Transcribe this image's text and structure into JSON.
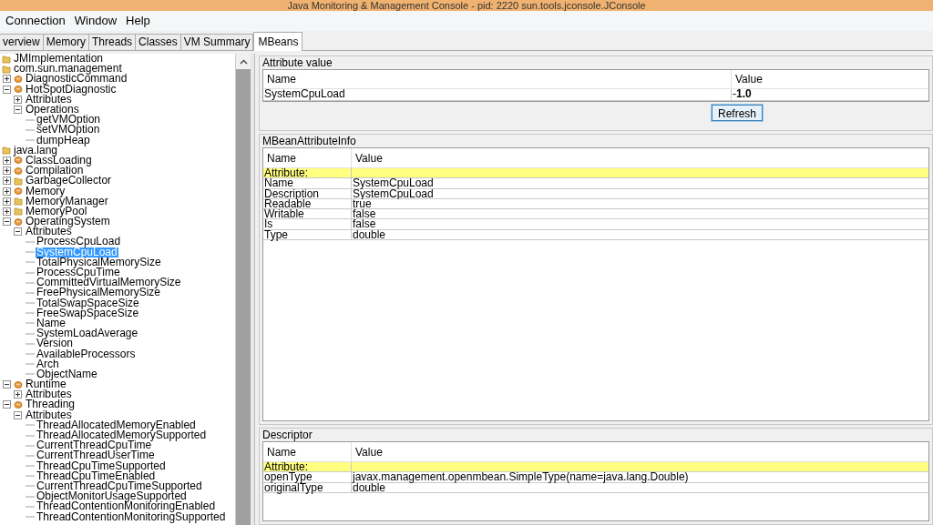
{
  "window": {
    "title": "Java Monitoring & Management Console - pid: 2220 sun.tools.jconsole.JConsole"
  },
  "menu": [
    "Connection",
    "Window",
    "Help"
  ],
  "tabs": [
    {
      "label": "verview",
      "selected": false
    },
    {
      "label": "Memory",
      "selected": false
    },
    {
      "label": "Threads",
      "selected": false
    },
    {
      "label": "Classes",
      "selected": false
    },
    {
      "label": "VM Summary",
      "selected": false
    },
    {
      "label": "MBeans",
      "selected": true
    }
  ],
  "tree": [
    {
      "label": "JMImplementation",
      "kind": "folder",
      "selected": false
    },
    {
      "label": "com.sun.management",
      "kind": "folder",
      "selected": false,
      "children": [
        {
          "label": "DiagnosticCommand",
          "kind": "bean",
          "expanded": false,
          "selected": false
        },
        {
          "label": "HotSpotDiagnostic",
          "kind": "bean",
          "expanded": true,
          "selected": false,
          "children": [
            {
              "label": "Attributes",
              "kind": "group",
              "expanded": false,
              "selected": false
            },
            {
              "label": "Operations",
              "kind": "group",
              "expanded": true,
              "selected": false,
              "children": [
                {
                  "label": "getVMOption",
                  "kind": "leaf",
                  "selected": false
                },
                {
                  "label": "setVMOption",
                  "kind": "leaf",
                  "selected": false
                },
                {
                  "label": "dumpHeap",
                  "kind": "leaf",
                  "selected": false
                }
              ]
            }
          ]
        }
      ]
    },
    {
      "label": "java.lang",
      "kind": "folder",
      "selected": false,
      "children": [
        {
          "label": "ClassLoading",
          "kind": "bean",
          "expanded": false,
          "selected": false
        },
        {
          "label": "Compilation",
          "kind": "bean",
          "expanded": false,
          "selected": false
        },
        {
          "label": "GarbageCollector",
          "kind": "folder",
          "expanded": false,
          "selected": false
        },
        {
          "label": "Memory",
          "kind": "bean",
          "expanded": false,
          "selected": false
        },
        {
          "label": "MemoryManager",
          "kind": "folder",
          "expanded": false,
          "selected": false
        },
        {
          "label": "MemoryPool",
          "kind": "folder",
          "expanded": false,
          "selected": false
        },
        {
          "label": "OperatingSystem",
          "kind": "bean",
          "expanded": true,
          "selected": false,
          "children": [
            {
              "label": "Attributes",
              "kind": "group",
              "expanded": true,
              "selected": false,
              "children": [
                {
                  "label": "ProcessCpuLoad",
                  "kind": "leaf",
                  "selected": false
                },
                {
                  "label": "SystemCpuLoad",
                  "kind": "leaf",
                  "selected": true
                },
                {
                  "label": "TotalPhysicalMemorySize",
                  "kind": "leaf",
                  "selected": false
                },
                {
                  "label": "ProcessCpuTime",
                  "kind": "leaf",
                  "selected": false
                },
                {
                  "label": "CommittedVirtualMemorySize",
                  "kind": "leaf",
                  "selected": false
                },
                {
                  "label": "FreePhysicalMemorySize",
                  "kind": "leaf",
                  "selected": false
                },
                {
                  "label": "TotalSwapSpaceSize",
                  "kind": "leaf",
                  "selected": false
                },
                {
                  "label": "FreeSwapSpaceSize",
                  "kind": "leaf",
                  "selected": false
                },
                {
                  "label": "Name",
                  "kind": "leaf",
                  "selected": false
                },
                {
                  "label": "SystemLoadAverage",
                  "kind": "leaf",
                  "selected": false
                },
                {
                  "label": "Version",
                  "kind": "leaf",
                  "selected": false
                },
                {
                  "label": "AvailableProcessors",
                  "kind": "leaf",
                  "selected": false
                },
                {
                  "label": "Arch",
                  "kind": "leaf",
                  "selected": false
                },
                {
                  "label": "ObjectName",
                  "kind": "leaf",
                  "selected": false
                }
              ]
            }
          ]
        },
        {
          "label": "Runtime",
          "kind": "bean",
          "expanded": true,
          "selected": false,
          "children": [
            {
              "label": "Attributes",
              "kind": "group",
              "expanded": false,
              "selected": false
            }
          ]
        },
        {
          "label": "Threading",
          "kind": "bean",
          "expanded": true,
          "selected": false,
          "children": [
            {
              "label": "Attributes",
              "kind": "group",
              "expanded": true,
              "selected": false,
              "children": [
                {
                  "label": "ThreadAllocatedMemoryEnabled",
                  "kind": "leaf",
                  "selected": false
                },
                {
                  "label": "ThreadAllocatedMemorySupported",
                  "kind": "leaf",
                  "selected": false
                },
                {
                  "label": "CurrentThreadCpuTime",
                  "kind": "leaf",
                  "selected": false
                },
                {
                  "label": "CurrentThreadUserTime",
                  "kind": "leaf",
                  "selected": false
                },
                {
                  "label": "ThreadCpuTimeSupported",
                  "kind": "leaf",
                  "selected": false
                },
                {
                  "label": "ThreadCpuTimeEnabled",
                  "kind": "leaf",
                  "selected": false
                },
                {
                  "label": "CurrentThreadCpuTimeSupported",
                  "kind": "leaf",
                  "selected": false
                },
                {
                  "label": "ObjectMonitorUsageSupported",
                  "kind": "leaf",
                  "selected": false
                },
                {
                  "label": "ThreadContentionMonitoringEnabled",
                  "kind": "leaf",
                  "selected": false
                },
                {
                  "label": "ThreadContentionMonitoringSupported",
                  "kind": "leaf",
                  "selected": false
                }
              ]
            }
          ]
        }
      ]
    }
  ],
  "attribute_value": {
    "title": "Attribute value",
    "columns": [
      "Name",
      "Value"
    ],
    "rows": [
      {
        "name": "SystemCpuLoad",
        "value": "-**1.0**"
      }
    ],
    "button": "Refresh"
  },
  "attribute_info": {
    "title": "MBeanAttributeInfo",
    "columns": [
      "Name",
      "Value"
    ],
    "rows": [
      {
        "kind": "section",
        "name": "Attribute:"
      },
      {
        "kind": "row",
        "name": "Name",
        "value": "SystemCpuLoad"
      },
      {
        "kind": "row",
        "name": "Description",
        "value": "SystemCpuLoad"
      },
      {
        "kind": "row",
        "name": "Readable",
        "value": "true"
      },
      {
        "kind": "row",
        "name": "Writable",
        "value": "false"
      },
      {
        "kind": "row",
        "name": "Is",
        "value": "false"
      },
      {
        "kind": "row",
        "name": "Type",
        "value": "double"
      }
    ]
  },
  "descriptor": {
    "title": "Descriptor",
    "columns": [
      "Name",
      "Value"
    ],
    "rows": [
      {
        "kind": "section",
        "name": "Attribute:"
      },
      {
        "kind": "row",
        "name": "openType",
        "value": "javax.management.openmbean.SimpleType(name=java.lang.Double)"
      },
      {
        "kind": "row",
        "name": "originalType",
        "value": "double"
      }
    ]
  }
}
